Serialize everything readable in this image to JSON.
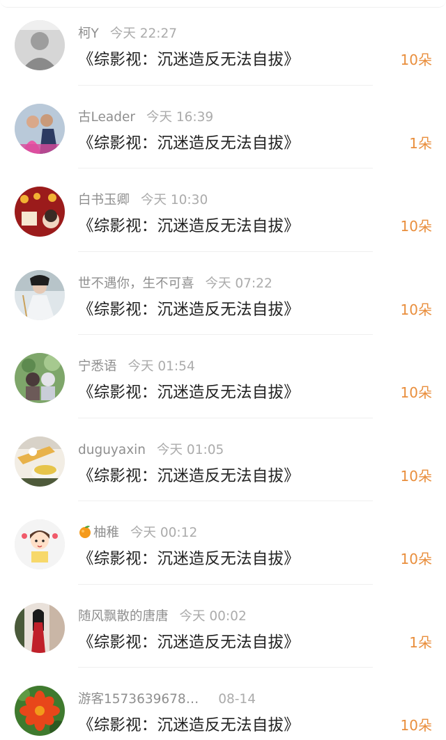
{
  "accent_color": "#e98e3c",
  "records": [
    {
      "username": "柯Y",
      "time": "今天 22:27",
      "book": "《综影视：沉迷造反无法自拔》",
      "count": "10朵",
      "avatar_icon": "user-avatar-grayscale-photo"
    },
    {
      "username": "古Leader",
      "time": "今天 16:39",
      "book": "《综影视：沉迷造反无法自拔》",
      "count": "1朵",
      "avatar_icon": "user-avatar-couple-photo"
    },
    {
      "username": "白书玉卿",
      "time": "今天 10:30",
      "book": "《综影视：沉迷造反无法自拔》",
      "count": "10朵",
      "avatar_icon": "user-avatar-red-lantern"
    },
    {
      "username": "世不遇你，生不可喜",
      "time": "今天 07:22",
      "book": "《综影视：沉迷造反无法自拔》",
      "count": "10朵",
      "avatar_icon": "user-avatar-costume-figure"
    },
    {
      "username": "宁悉语",
      "time": "今天 01:54",
      "book": "《综影视：沉迷造反无法自拔》",
      "count": "10朵",
      "avatar_icon": "user-avatar-chibi-pair"
    },
    {
      "username": "duguyaxin",
      "time": "今天 01:05",
      "book": "《综影视：沉迷造反无法自拔》",
      "count": "10朵",
      "avatar_icon": "user-avatar-tea-cup"
    },
    {
      "username": "柚稚",
      "username_emoji": "orange-fruit-icon",
      "time": "今天 00:12",
      "book": "《综影视：沉迷造反无法自拔》",
      "count": "10朵",
      "avatar_icon": "user-avatar-cartoon-girl"
    },
    {
      "username": "随风飘散的唐唐",
      "time": "今天 00:02",
      "book": "《综影视：沉迷造反无法自拔》",
      "count": "1朵",
      "avatar_icon": "user-avatar-woman-red-dress"
    },
    {
      "username": "游客1573639678…",
      "time": "08-14",
      "book": "《综影视：沉迷造反无法自拔》",
      "count": "10朵",
      "avatar_icon": "user-avatar-red-flower"
    }
  ]
}
